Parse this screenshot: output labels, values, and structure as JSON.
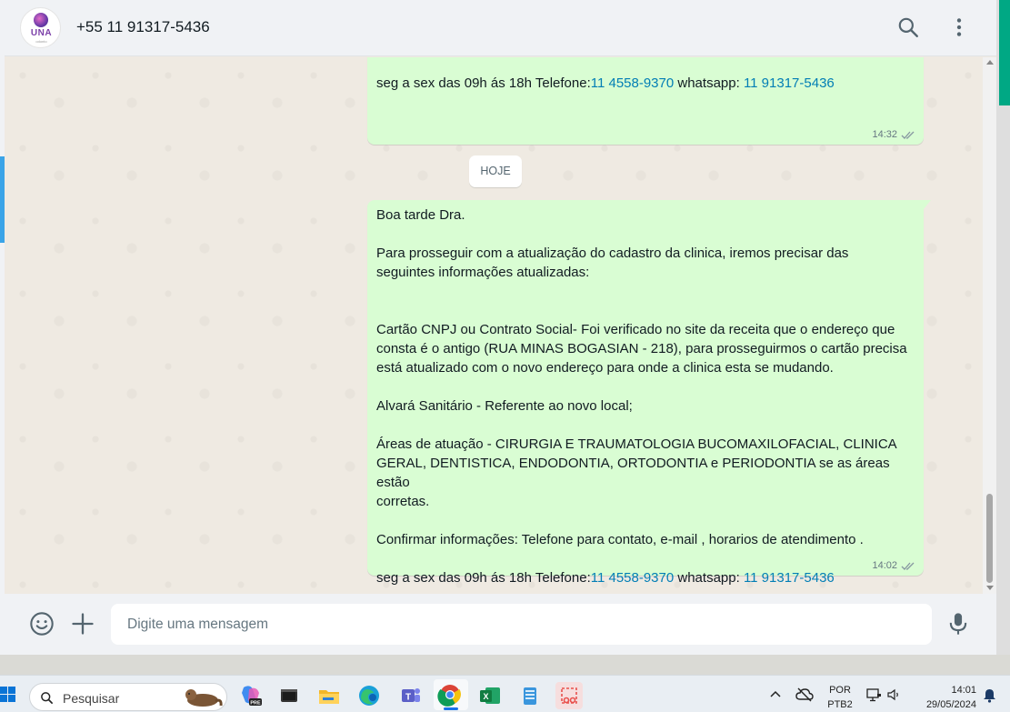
{
  "header": {
    "contact_name": "+55 11 91317-5436",
    "avatar_text": "UNA",
    "avatar_sub": "odonto"
  },
  "chat": {
    "date_divider": "HOJE",
    "messages": [
      {
        "lines": [
          {
            "t": "Confirmar informações: Telefone para contato, e-mail , horarios de atendimento ."
          },
          {
            "t": ""
          },
          {
            "pre": "seg a sex das 09h ás 18h Telefone:",
            "link1": "11 4558-9370",
            "mid": " whatsapp: ",
            "link2": "11 91317-5436"
          }
        ],
        "time": "14:32"
      },
      {
        "lines": [
          {
            "t": "Boa tarde Dra."
          },
          {
            "t": ""
          },
          {
            "t": "Para prosseguir com a atualização do cadastro da clinica, iremos precisar das"
          },
          {
            "t": "seguintes informações atualizadas:"
          },
          {
            "t": ""
          },
          {
            "t": ""
          },
          {
            "t": "Cartão CNPJ ou Contrato Social- Foi verificado no site da receita que o endereço que"
          },
          {
            "t": "consta é o antigo (RUA MINAS BOGASIAN - 218), para prosseguirmos o cartão precisa"
          },
          {
            "t": "está atualizado com o novo endereço para onde a clinica esta se mudando."
          },
          {
            "t": ""
          },
          {
            "t": "Alvará Sanitário - Referente ao novo local;"
          },
          {
            "t": ""
          },
          {
            "t": "Áreas de atuação - CIRURGIA E TRAUMATOLOGIA BUCOMAXILOFACIAL, CLINICA"
          },
          {
            "t": "GERAL, DENTISTICA, ENDODONTIA, ORTODONTIA e PERIODONTIA se as áreas estão"
          },
          {
            "t": "corretas."
          },
          {
            "t": ""
          },
          {
            "t": "Confirmar informações: Telefone para contato, e-mail , horarios de atendimento ."
          },
          {
            "t": ""
          },
          {
            "pre": "seg a sex das 09h ás 18h Telefone:",
            "link1": "11 4558-9370",
            "mid": " whatsapp: ",
            "link2": "11 91317-5436"
          }
        ],
        "time": "14:02"
      }
    ]
  },
  "composer": {
    "placeholder": "Digite uma mensagem"
  },
  "taskbar": {
    "search_placeholder": "Pesquisar",
    "lang_top": "POR",
    "lang_bottom": "PTB2",
    "time": "14:01",
    "date": "29/05/2024",
    "apps": [
      "copilot",
      "terminal",
      "file-explorer",
      "edge",
      "teams",
      "chrome",
      "excel",
      "notepad",
      "snipping-tool"
    ]
  },
  "colors": {
    "outgoing_bubble": "#d9fdd3",
    "link": "#027eb5",
    "accent": "#00a884",
    "chat_bg": "#efeae2"
  }
}
